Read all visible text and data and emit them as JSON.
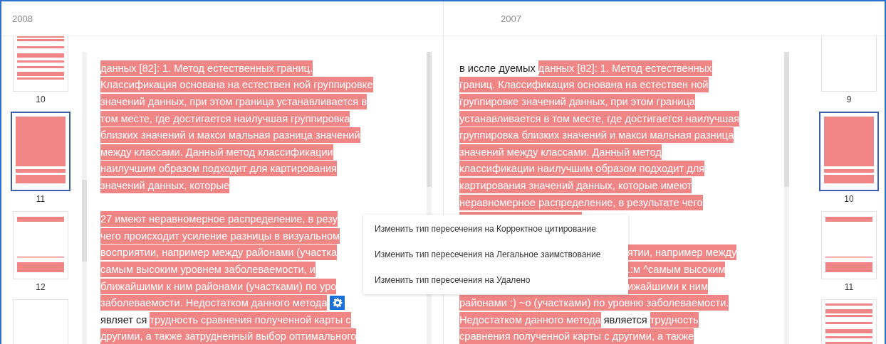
{
  "columns": [
    {
      "year": "2008",
      "thumbnails": [
        {
          "kind": "striped",
          "label": "10",
          "selected": false
        },
        {
          "kind": "solid",
          "label": "11",
          "selected": true
        },
        {
          "kind": "bars",
          "label": "12",
          "selected": false
        },
        {
          "kind": "blank",
          "selected": false
        }
      ],
      "lines": [
        {
          "kind": "full",
          "segments": [
            {
              "kind": "highlight",
              "text": " данных [82]: 1. Метод естественных границ."
            }
          ]
        },
        {
          "kind": "full",
          "segments": [
            {
              "kind": "highlight",
              "text": "Классификация основана на естествен ной группировке"
            }
          ]
        },
        {
          "kind": "full",
          "segments": [
            {
              "kind": "highlight",
              "text": "значений данных, при этом граница устанавливается в"
            }
          ]
        },
        {
          "kind": "full",
          "segments": [
            {
              "kind": "highlight",
              "text": "том месте, где достигается наилучшая группировка"
            }
          ]
        },
        {
          "kind": "full",
          "segments": [
            {
              "kind": "highlight",
              "text": "близких значений и макси мальная разница значений"
            }
          ]
        },
        {
          "kind": "full",
          "segments": [
            {
              "kind": "highlight",
              "text": "между классами. Данный метод классификации"
            }
          ]
        },
        {
          "kind": "full",
          "segments": [
            {
              "kind": "highlight",
              "text": "наилучшим образом подходит для картирования"
            }
          ]
        },
        {
          "kind": "full",
          "segments": [
            {
              "kind": "highlight",
              "text": "значений данных, которые"
            }
          ]
        },
        {
          "kind": "blank"
        },
        {
          "kind": "full",
          "segments": [
            {
              "kind": "highlight",
              "text": "27 имеют неравномерное распределение, в резу"
            }
          ]
        },
        {
          "kind": "full",
          "segments": [
            {
              "kind": "highlight",
              "text": "чего происходит усиление разницы в визуальном"
            }
          ]
        },
        {
          "kind": "full",
          "segments": [
            {
              "kind": "highlight",
              "text": "восприятии, например между районами (участка"
            }
          ]
        },
        {
          "kind": "full",
          "segments": [
            {
              "kind": "highlight",
              "text": "самым высоким уровнем заболеваемости, и"
            }
          ]
        },
        {
          "kind": "full",
          "segments": [
            {
              "kind": "highlight",
              "text": "ближайшими к ним районами (участками) по уро"
            }
          ]
        },
        {
          "kind": "full",
          "segments": [
            {
              "kind": "highlight",
              "text": "заболеваемости. Недостатком данного метода"
            },
            {
              "kind": "gear"
            }
          ]
        },
        {
          "kind": "full",
          "segments": [
            {
              "kind": "plain",
              "text": "являет ся"
            },
            {
              "kind": "highlight",
              "text": "трудность сравнения полученной карты с"
            }
          ]
        },
        {
          "kind": "full",
          "segments": [
            {
              "kind": "highlight",
              "text": "другими, а также затрудненный выбор оптимального"
            }
          ]
        }
      ]
    },
    {
      "year": "2007",
      "thumbnails": [
        {
          "kind": "blank",
          "label": "9",
          "selected": false
        },
        {
          "kind": "solid",
          "label": "10",
          "selected": true
        },
        {
          "kind": "bars",
          "label": "11",
          "selected": false
        },
        {
          "kind": "striped",
          "selected": false
        }
      ],
      "lines": [
        {
          "kind": "full",
          "segments": [
            {
              "kind": "plain",
              "text": "в иссле дуемых"
            },
            {
              "kind": "highlight",
              "text": "данных [82]: 1. Метод естественных"
            }
          ]
        },
        {
          "kind": "full",
          "segments": [
            {
              "kind": "highlight",
              "text": "границ. Классификация основана на естествен ной"
            }
          ]
        },
        {
          "kind": "full",
          "segments": [
            {
              "kind": "highlight",
              "text": "группировке значений данных, при этом граница"
            }
          ]
        },
        {
          "kind": "full",
          "segments": [
            {
              "kind": "highlight",
              "text": "устанавливается в том месте, где достигается наилучшая"
            }
          ]
        },
        {
          "kind": "full",
          "segments": [
            {
              "kind": "highlight",
              "text": "группировка близких значений и макси мальная разница"
            }
          ]
        },
        {
          "kind": "full",
          "segments": [
            {
              "kind": "highlight",
              "text": "значений между классами. Данный метод"
            }
          ]
        },
        {
          "kind": "full",
          "segments": [
            {
              "kind": "highlight",
              "text": "классификации наилучшим образом подходит для"
            }
          ]
        },
        {
          "kind": "full",
          "segments": [
            {
              "kind": "highlight",
              "text": "картирования значений данных, которые имеют"
            }
          ]
        },
        {
          "kind": "full",
          "segments": [
            {
              "kind": "highlight",
              "text": "неравномерное распределение, в результате чего"
            }
          ]
        },
        {
          "kind": "covered"
        },
        {
          "kind": "blank"
        },
        {
          "kind": "tail",
          "segments": [
            {
              "kind": "highlight",
              "text": "ятии, например между"
            }
          ]
        },
        {
          "kind": "tail",
          "segments": [
            {
              "kind": "highlight",
              "text": ".:м ^самым высоким"
            }
          ]
        },
        {
          "kind": "tail",
          "segments": [
            {
              "kind": "highlight",
              "text": "ижайшими к ним"
            }
          ]
        },
        {
          "kind": "full",
          "segments": [
            {
              "kind": "highlight",
              "text": "районами :) ~о (участками) по уровню заболеваемости."
            }
          ]
        },
        {
          "kind": "full",
          "segments": [
            {
              "kind": "highlight",
              "text": "Недостатком данного метода"
            },
            {
              "kind": "plain",
              "text": "является"
            },
            {
              "kind": "highlight",
              "text": "трудность"
            }
          ]
        },
        {
          "kind": "full",
          "segments": [
            {
              "kind": "highlight",
              "text": "сравнения полученной карты с другими, а также"
            }
          ]
        }
      ]
    }
  ],
  "menu": {
    "items": [
      {
        "label": "Изменить тип пересечения на Корректное цитирование"
      },
      {
        "label": "Изменить тип пересечения на Легальное заимствование"
      },
      {
        "label": "Изменить тип пересечения на Удалено"
      }
    ]
  }
}
